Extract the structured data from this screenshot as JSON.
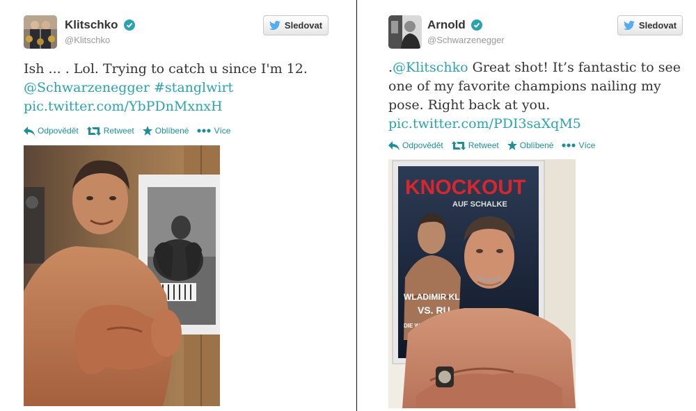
{
  "tweets": [
    {
      "display_name": "Klitschko",
      "handle": "@Klitschko",
      "follow_label": "Sledovat",
      "text_lines": [
        {
          "plain": "Ish ... . Lol. Trying to catch u since I'm 12."
        },
        {
          "link1": "@Schwarzenegger",
          "link2": "#stanglwirt"
        },
        {
          "link": "pic.twitter.com/YbPDnMxnxH"
        }
      ],
      "actions": {
        "reply": "Odpovědět",
        "retweet": "Retweet",
        "favorite": "Oblíbené",
        "more": "Více"
      }
    },
    {
      "display_name": "Arnold",
      "handle": "@Schwarzenegger",
      "follow_label": "Sledovat",
      "text_lines": [
        {
          "prefix": ".",
          "link": "@Klitschko",
          "rest": " Great shot! It’s fantastic to see"
        },
        {
          "plain": "one of my favorite champions nailing my"
        },
        {
          "plain": "pose. Right back at you."
        },
        {
          "link": "pic.twitter.com/PDI3saXqM5"
        }
      ],
      "actions": {
        "reply": "Odpovědět",
        "retweet": "Retweet",
        "favorite": "Oblíbené",
        "more": "Více"
      },
      "poster_text": {
        "title": "KNOCKOUT",
        "subtitle": "AUF SCHALKE",
        "name": "WLADIMIR KL",
        "vs": "VS. RU",
        "footer": "DIE WELTMEI"
      }
    }
  ],
  "colors": {
    "link": "#2aa3ae",
    "action": "#1c8f9a",
    "verified": "#2aa3ae",
    "twitter_bird": "#55acee"
  },
  "icons": [
    "verified-badge-icon",
    "twitter-bird-icon",
    "reply-icon",
    "retweet-icon",
    "star-icon",
    "more-dots-icon"
  ]
}
